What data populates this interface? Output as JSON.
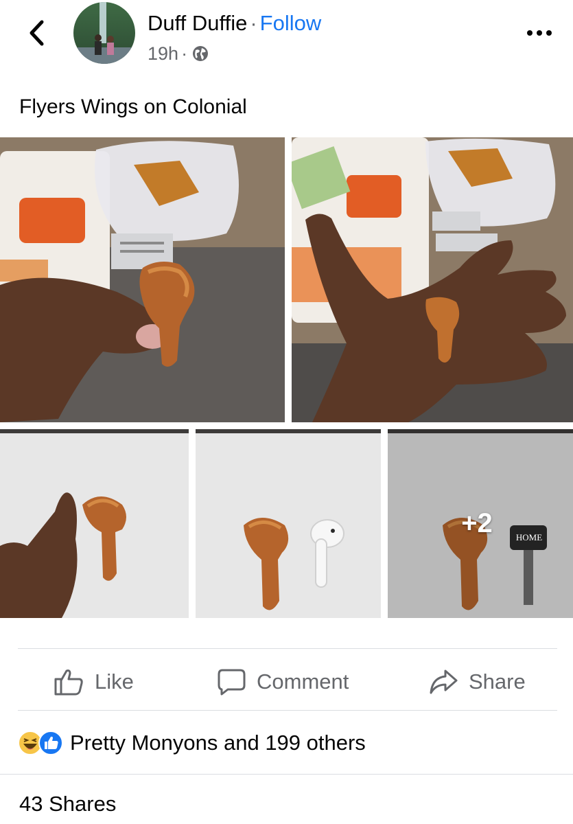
{
  "post": {
    "author": "Duff Duffie",
    "separator": "·",
    "follow_label": "Follow",
    "time": "19h",
    "time_separator": "·",
    "privacy_icon": "globe-icon",
    "text": "Flyers Wings on Colonial"
  },
  "gallery": {
    "more_count_label": "+2",
    "key_label": "HOME"
  },
  "actions": {
    "like_label": "Like",
    "comment_label": "Comment",
    "share_label": "Share"
  },
  "reactions": {
    "icons": [
      "haha-reaction-icon",
      "like-reaction-icon"
    ],
    "summary": "Pretty Monyons and 199 others"
  },
  "shares": {
    "summary": "43 Shares"
  },
  "colors": {
    "accent": "#1877f2",
    "secondary_text": "#65676b",
    "divider": "#dadde1"
  }
}
